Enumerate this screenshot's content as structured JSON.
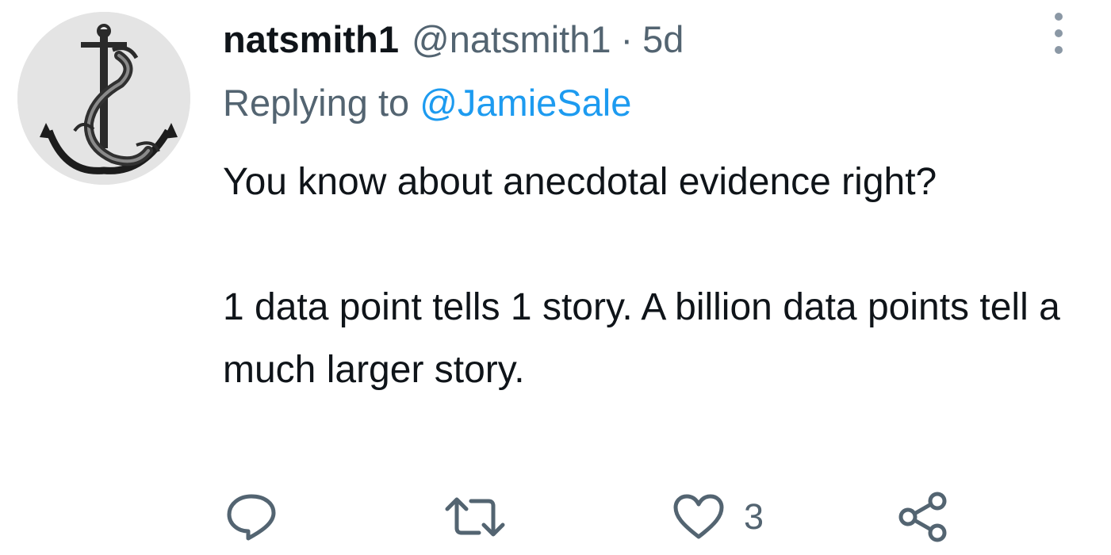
{
  "tweet": {
    "author": {
      "display_name": "natsmith1",
      "handle": "@natsmith1",
      "separator": "·",
      "time": "5d",
      "avatar": "anchor-dolphin-emblem"
    },
    "reply_prefix": "Replying to",
    "reply_to": "@JamieSale",
    "text": {
      "paragraph1": "You know about anecdotal evidence right?",
      "paragraph2": "1 data point tells 1 story. A billion data points tell a much larger story."
    },
    "actions": {
      "reply_icon": "reply-icon",
      "retweet_icon": "retweet-icon",
      "like_icon": "heart-icon",
      "like_count": "3",
      "share_icon": "share-icon"
    },
    "colors": {
      "text": "#0f1419",
      "secondary": "#536471",
      "link": "#1d9bf0"
    }
  }
}
